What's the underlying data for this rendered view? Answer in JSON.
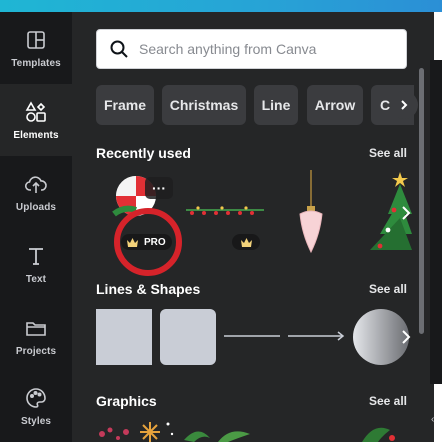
{
  "rail": {
    "items": [
      {
        "label": "Templates",
        "icon": "templates-icon"
      },
      {
        "label": "Elements",
        "icon": "elements-icon"
      },
      {
        "label": "Uploads",
        "icon": "uploads-icon"
      },
      {
        "label": "Text",
        "icon": "text-icon"
      },
      {
        "label": "Projects",
        "icon": "projects-icon"
      },
      {
        "label": "Styles",
        "icon": "styles-icon"
      }
    ],
    "active": "Elements"
  },
  "search": {
    "placeholder": "Search anything from Canva"
  },
  "chips": [
    "Frame",
    "Christmas",
    "Line",
    "Arrow",
    "Circ"
  ],
  "sections": {
    "recent": {
      "title": "Recently used",
      "see_all": "See all",
      "pro_label": "PRO"
    },
    "lines": {
      "title": "Lines & Shapes",
      "see_all": "See all"
    },
    "graphics": {
      "title": "Graphics",
      "see_all": "See all"
    }
  },
  "colors": {
    "accent_ring": "#d6232a",
    "panel": "#252627",
    "rail": "#18191b"
  }
}
